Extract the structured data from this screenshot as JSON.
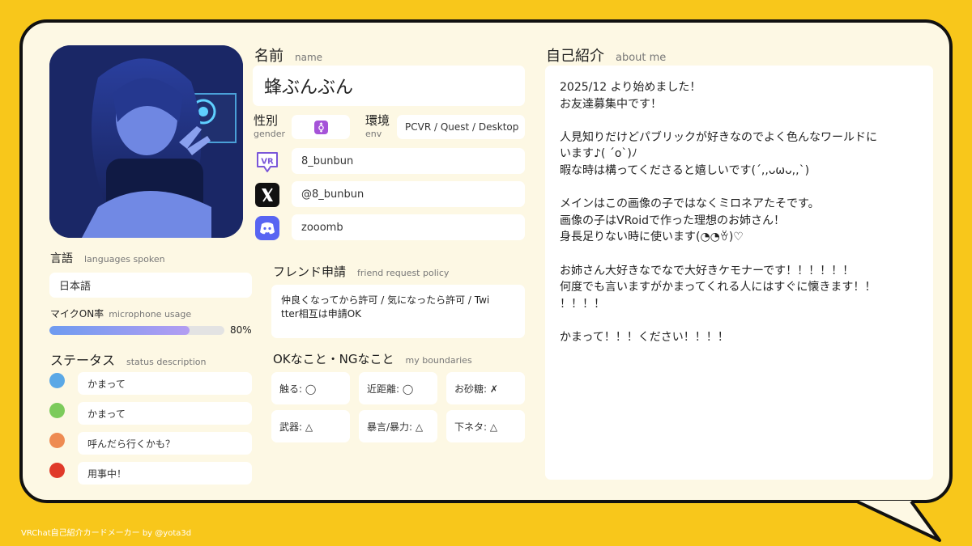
{
  "name": {
    "label": "名前",
    "sub": "name",
    "value": "蜂ぶんぶん"
  },
  "gender": {
    "label": "性別",
    "sub": "gender",
    "icon": "transgender-icon",
    "color": "#a553d8"
  },
  "env": {
    "label": "環境",
    "sub": "env",
    "value": "PCVR / Quest / Desktop"
  },
  "accounts": {
    "vrchat": {
      "icon": "vrchat-icon",
      "value": "8_bunbun"
    },
    "x": {
      "icon": "x-icon",
      "value": "@8_bunbun"
    },
    "discord": {
      "icon": "discord-icon",
      "value": "zooomb"
    }
  },
  "languages": {
    "label": "言語",
    "sub": "languages spoken",
    "value": "日本語"
  },
  "microphone": {
    "label": "マイクON率",
    "sub": "microphone usage",
    "value_text": "80%",
    "value": 0.8
  },
  "status": {
    "label": "ステータス",
    "sub": "status description",
    "items": [
      {
        "color": "#5aa8e6",
        "text": "かまって"
      },
      {
        "color": "#7ccb5b",
        "text": "かまって"
      },
      {
        "color": "#ee8b52",
        "text": "呼んだら行くかも？"
      },
      {
        "color": "#e03a2a",
        "text": "用事中！"
      }
    ]
  },
  "friend": {
    "label": "フレンド申請",
    "sub": "friend request policy",
    "line1": "仲良くなってから許可 / 気になったら許可 / Twi",
    "line2": "tter相互は申請OK"
  },
  "boundaries": {
    "label": "OKなこと・NGなこと",
    "sub": "my boundaries",
    "items": [
      "触る: ◯",
      "近距離: ◯",
      "お砂糖: ✗",
      "武器: △",
      "暴言/暴力: △",
      "下ネタ: △"
    ]
  },
  "about": {
    "label": "自己紹介",
    "sub": "about me",
    "lines": [
      "2025/12 より始めました！",
      "お友達募集中です！",
      "",
      "人見知りだけどパブリックが好きなのでよく色んなワールドに",
      "います♪( ´o`)ﾉ",
      "暇な時は構ってくださると嬉しいです(ˊ,,ᴗωᴗ,,ˋ)",
      "",
      "メインはこの画像の子ではなくミロネアたそです。",
      "画像の子はVRoidで作った理想のお姉さん！",
      "身長足りない時に使います(◔◔ꈊ)♡",
      "",
      "お姉さん大好きなでなで大好きケモナーです！！！！！！",
      "何度でも言いますがかまってくれる人にはすぐに懐きます！！",
      "！！！！",
      "",
      "かまって！！！ください！！！！"
    ]
  },
  "footer": "VRChat自己紹介カードメーカー by @yota3d"
}
